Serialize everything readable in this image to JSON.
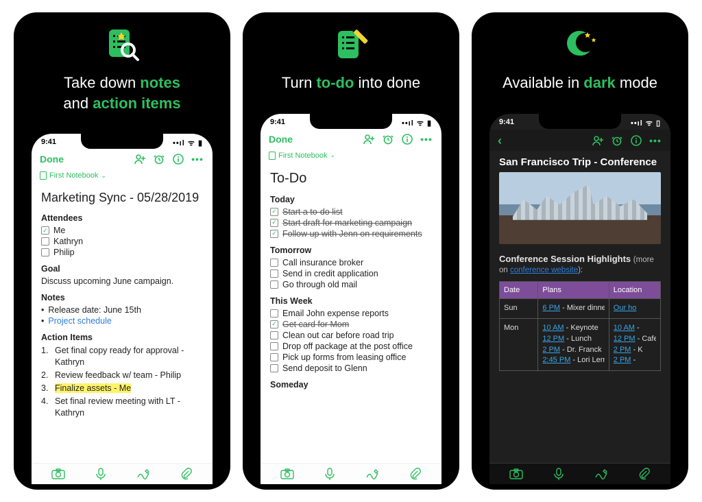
{
  "panels": [
    {
      "tagline_parts": [
        "Take down ",
        "notes",
        "\nand ",
        "action items"
      ],
      "accent_indices": [
        1,
        3
      ]
    },
    {
      "tagline_parts": [
        "Turn ",
        "to-do",
        " into done"
      ],
      "accent_indices": [
        1
      ]
    },
    {
      "tagline_parts": [
        "Available in ",
        "dark",
        " mode"
      ],
      "accent_indices": [
        1
      ]
    }
  ],
  "status_time": "9:41",
  "toolbar": {
    "done_label": "Done"
  },
  "notebook_label": "First Notebook",
  "note1": {
    "title": "Marketing Sync - 05/28/2019",
    "attendees_label": "Attendees",
    "attendees": [
      {
        "label": "Me",
        "checked": true
      },
      {
        "label": "Kathryn",
        "checked": false
      },
      {
        "label": "Philip",
        "checked": false
      }
    ],
    "goal_label": "Goal",
    "goal_text": "Discuss upcoming June campaign.",
    "notes_label": "Notes",
    "notes": [
      {
        "text": "Release date: June 15th"
      },
      {
        "text": "Project schedule",
        "link": true
      }
    ],
    "action_label": "Action Items",
    "actions": [
      "Get final copy ready for approval - Kathryn",
      "Review feedback w/ team - Philip",
      "Finalize assets - Me",
      "Set final review meeting with LT - Kathryn"
    ],
    "highlight_index": 2
  },
  "note2": {
    "title": "To-Do",
    "sections": [
      {
        "label": "Today",
        "items": [
          {
            "label": "Start a to-do list",
            "checked": true
          },
          {
            "label": "Start draft for marketing campaign",
            "checked": true
          },
          {
            "label": "Follow up with Jenn on requirements",
            "checked": true
          }
        ]
      },
      {
        "label": "Tomorrow",
        "items": [
          {
            "label": "Call insurance broker",
            "checked": false
          },
          {
            "label": "Send in credit application",
            "checked": false
          },
          {
            "label": "Go through old mail",
            "checked": false
          }
        ]
      },
      {
        "label": "This Week",
        "items": [
          {
            "label": "Email John expense reports",
            "checked": false
          },
          {
            "label": "Get card for Mom",
            "checked": true
          },
          {
            "label": "Clean out car before road trip",
            "checked": false
          },
          {
            "label": "Drop off package at the post office",
            "checked": false
          },
          {
            "label": "Pick up forms from leasing office",
            "checked": false
          },
          {
            "label": "Send deposit to Glenn",
            "checked": false
          }
        ]
      },
      {
        "label": "Someday",
        "items": []
      }
    ]
  },
  "note3": {
    "title": "San Francisco Trip - Conference",
    "highlights_label": "Conference Session Highlights",
    "more_label": "(more on ",
    "more_link": "conference website",
    "more_close": "):",
    "columns": [
      "Date",
      "Plans",
      "Location"
    ],
    "rows": [
      {
        "date": "Sun",
        "plans": [
          {
            "time": "6 PM",
            "text": " - Mixer dinner"
          }
        ],
        "loc": [
          {
            "text": "Our ho",
            "link": true
          }
        ]
      },
      {
        "date": "Mon",
        "plans": [
          {
            "time": "10 AM",
            "text": " - Keynote"
          },
          {
            "time": "12 PM",
            "text": " - Lunch"
          },
          {
            "time": "2 PM",
            "text": " - Dr. Franck"
          },
          {
            "time": "2:45 PM",
            "text": " - Lori Lerne"
          }
        ],
        "loc": [
          {
            "time": "10 AM",
            "text": " - "
          },
          {
            "time": "12 PM",
            "text": " - Cafeteri"
          },
          {
            "time": "2 PM",
            "text": " - K"
          },
          {
            "time": "2 PM",
            "text": " - "
          }
        ]
      }
    ]
  }
}
